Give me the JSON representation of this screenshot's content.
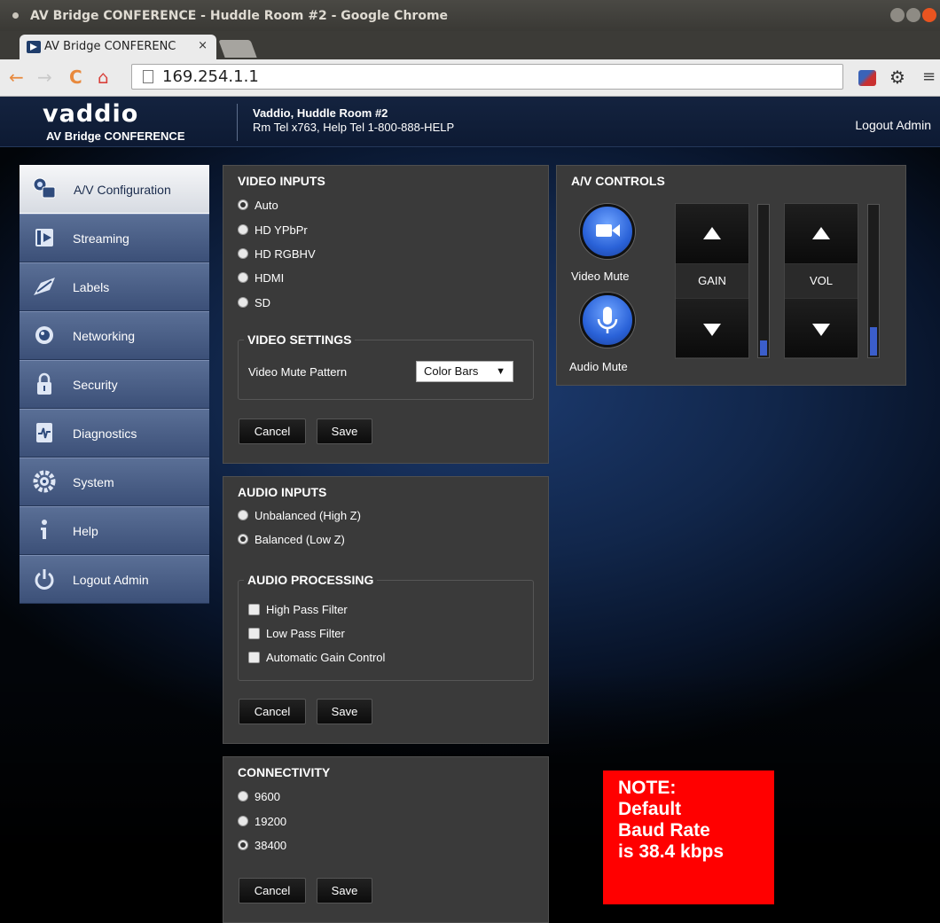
{
  "window": {
    "title": "AV Bridge CONFERENCE - Huddle Room #2 - Google Chrome"
  },
  "tab": {
    "title": "AV Bridge CONFERENC",
    "close": "×"
  },
  "toolbar": {
    "url": "169.254.1.1"
  },
  "header": {
    "logo": "vaddio",
    "product": "AV Bridge CONFERENCE",
    "room_name": "Vaddio, Huddle Room #2",
    "room_tel": "Rm Tel x763, Help Tel 1-800-888-HELP",
    "logout": "Logout Admin"
  },
  "sidebar": {
    "items": [
      {
        "label": "A/V Configuration",
        "icon": "av-config-icon"
      },
      {
        "label": "Streaming",
        "icon": "streaming-icon"
      },
      {
        "label": "Labels",
        "icon": "labels-icon"
      },
      {
        "label": "Networking",
        "icon": "networking-icon"
      },
      {
        "label": "Security",
        "icon": "lock-icon"
      },
      {
        "label": "Diagnostics",
        "icon": "diagnostics-icon"
      },
      {
        "label": "System",
        "icon": "system-gear-icon"
      },
      {
        "label": "Help",
        "icon": "help-icon"
      },
      {
        "label": "Logout Admin",
        "icon": "power-icon"
      }
    ],
    "active_index": 0
  },
  "video_inputs": {
    "title": "VIDEO INPUTS",
    "options": [
      "Auto",
      "HD YPbPr",
      "HD RGBHV",
      "HDMI",
      "SD"
    ],
    "selected": "Auto",
    "settings_title": "VIDEO SETTINGS",
    "mute_pattern_label": "Video Mute Pattern",
    "mute_pattern_value": "Color Bars",
    "cancel": "Cancel",
    "save": "Save"
  },
  "audio_inputs": {
    "title": "AUDIO INPUTS",
    "options": [
      "Unbalanced (High Z)",
      "Balanced (Low Z)"
    ],
    "selected": "Balanced (Low Z)",
    "processing_title": "AUDIO PROCESSING",
    "processing": [
      "High Pass Filter",
      "Low Pass Filter",
      "Automatic Gain Control"
    ],
    "cancel": "Cancel",
    "save": "Save"
  },
  "connectivity": {
    "title": "CONNECTIVITY",
    "options": [
      "9600",
      "19200",
      "38400"
    ],
    "selected": "38400",
    "cancel": "Cancel",
    "save": "Save"
  },
  "av_controls": {
    "title": "A/V CONTROLS",
    "video_mute": "Video Mute",
    "audio_mute": "Audio Mute",
    "gain_label": "GAIN",
    "vol_label": "VOL",
    "gain_meter_fraction": 0.1,
    "vol_meter_fraction": 0.19
  },
  "note": {
    "lines": [
      "NOTE:",
      "Default",
      "Baud Rate",
      "is 38.4 kbps"
    ]
  },
  "colors": {
    "accent_blue": "#2a62d8",
    "note_red": "#ff0000",
    "panel_bg": "#3a3a3a"
  }
}
